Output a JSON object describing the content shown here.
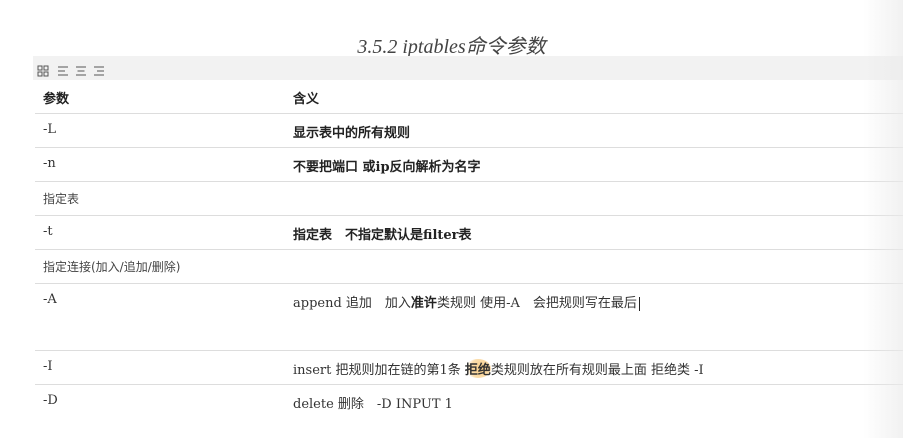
{
  "title": "3.5.2 iptables命令参数",
  "header": {
    "col1": "参数",
    "col2": "含义"
  },
  "rows": [
    {
      "c1": "-L",
      "c2": "显示表中的所有规则"
    },
    {
      "c1": "-n",
      "c2": "不要把端口 或ip反向解析为名字"
    },
    {
      "c1": "指定表"
    },
    {
      "c1": "-t",
      "c2": "指定表　不指定默认是filter表"
    },
    {
      "c1": "指定连接(加入/追加/删除)"
    },
    {
      "c1": "-A",
      "c2_a": "append 追加　加入",
      "c2_b": "准许",
      "c2_c": "类规则 使用-A　会把规则写在最后"
    },
    {
      "c1": "-I",
      "c2_a": "insert 把规则加在链的第1条 ",
      "c2_b": "拒绝",
      "c2_c": "类规则放在所有规则最上面 拒绝类 -I"
    },
    {
      "c1": "-D",
      "c2": "delete 删除　-D INPUT 1"
    }
  ],
  "toolbar": {
    "icons": [
      "grid-icon",
      "align-left-icon",
      "align-center-icon",
      "align-right-icon"
    ]
  }
}
